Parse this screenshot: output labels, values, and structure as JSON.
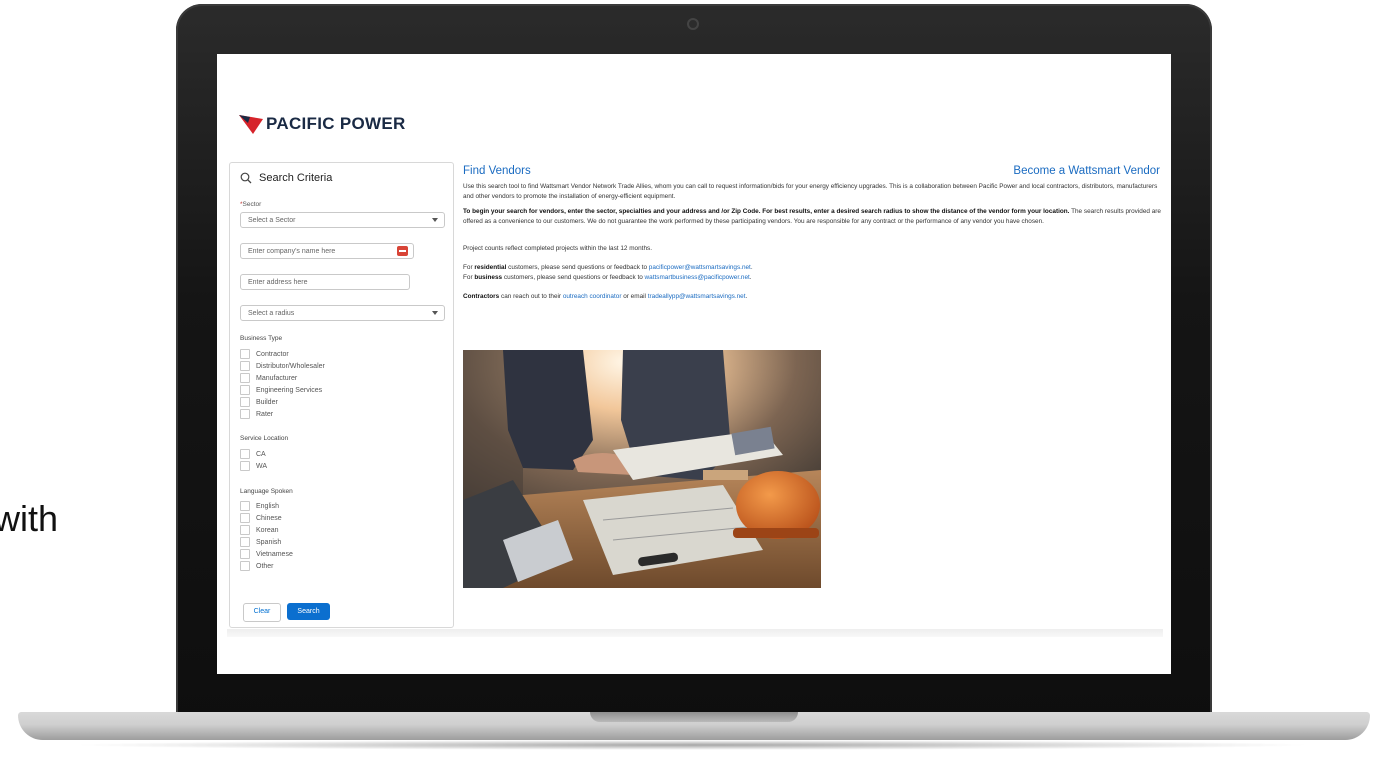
{
  "slide": {
    "partial_text": "with"
  },
  "brand": {
    "name": "PACIFIC POWER",
    "accent": "#d6232a",
    "link_color": "#1a6bc1",
    "button_color": "#0b6fcf"
  },
  "search_panel": {
    "title": "Search Criteria",
    "sector_label": "Sector",
    "required_mark": "*",
    "sector_placeholder": "Select a Sector",
    "company_placeholder": "Enter company's name here",
    "address_placeholder": "Enter address here",
    "radius_placeholder": "Select a radius",
    "business_type_label": "Business Type",
    "business_types": [
      "Contractor",
      "Distributor/Wholesaler",
      "Manufacturer",
      "Engineering Services",
      "Builder",
      "Rater"
    ],
    "service_location_label": "Service Location",
    "service_locations": [
      "CA",
      "WA"
    ],
    "language_label": "Language Spoken",
    "languages": [
      "English",
      "Chinese",
      "Korean",
      "Spanish",
      "Vietnamese",
      "Other"
    ],
    "clear_label": "Clear",
    "search_label": "Search"
  },
  "main": {
    "title": "Find Vendors",
    "become_link": "Become a Wattsmart Vendor",
    "intro": "Use this search tool to find Wattsmart Vendor Network Trade Allies, whom you can call to request information/bids for your energy efficiency upgrades. This is a collaboration between Pacific Power and local contractors, distributors, manufacturers and other vendors to promote the installation of energy-efficient equipment.",
    "instructions_bold": "To begin your search for vendors, enter the sector, specialties and your address and /or Zip Code.  For best results, enter a desired search radius to show the distance of the vendor form your location.",
    "instructions_rest": " The search results provided are offered as a convenience to our customers. We do not guarantee the work performed by these participating vendors.  You are responsible for any contract or the performance of any vendor you have chosen.",
    "project_counts": "Project counts reflect completed projects within the last 12 months.",
    "res_prefix": "For ",
    "res_bold": "residential",
    "res_mid": " customers, please send questions or feedback to ",
    "res_email": "pacificpower@wattsmartsavings.net",
    "res_end": ".",
    "bus_prefix": "For ",
    "bus_bold": "business",
    "bus_mid": " customers, please send questions or feedback to ",
    "bus_email": "wattsmartbusiness@pacificpower.net",
    "bus_end": ".",
    "contractors_bold": "Contractors",
    "contractors_mid": " can reach out to their ",
    "coordinator_link": "outreach coordinator",
    "contractors_or": " or email ",
    "contractors_email": "tradeallypp@wattsmartsavings.net",
    "contractors_end": "."
  }
}
